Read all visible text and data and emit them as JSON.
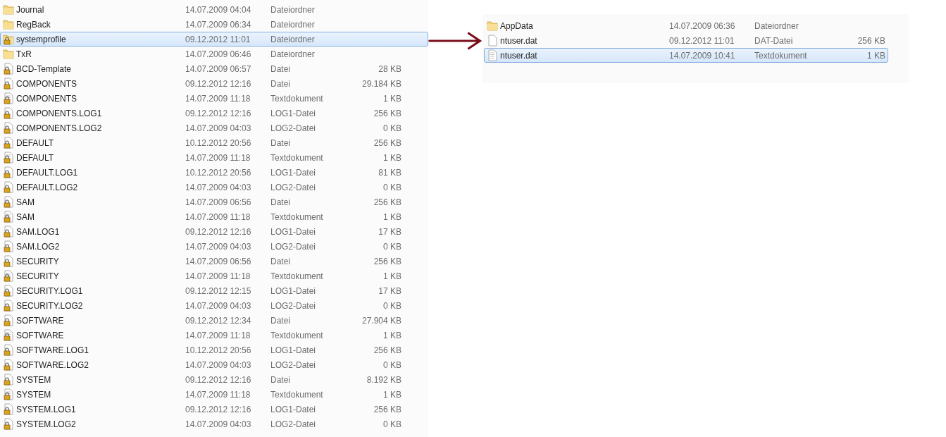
{
  "left_list": {
    "rows": [
      {
        "kind": "folder",
        "name": "Journal",
        "date": "14.07.2009 04:04",
        "type": "Dateiordner",
        "selected": false
      },
      {
        "kind": "folder",
        "name": "RegBack",
        "date": "14.07.2009 06:34",
        "type": "Dateiordner",
        "selected": false
      },
      {
        "kind": "locked-folder",
        "name": "systemprofile",
        "date": "09.12.2012 11:01",
        "type": "Dateiordner",
        "selected": true
      },
      {
        "kind": "folder",
        "name": "TxR",
        "date": "14.07.2009 06:46",
        "type": "Dateiordner",
        "selected": false
      },
      {
        "kind": "locked-file",
        "name": "BCD-Template",
        "date": "14.07.2009 06:57",
        "type": "Datei",
        "size": "28 KB",
        "selected": false
      },
      {
        "kind": "locked-file",
        "name": "COMPONENTS",
        "date": "09.12.2012 12:16",
        "type": "Datei",
        "size": "29.184 KB",
        "selected": false
      },
      {
        "kind": "locked-text",
        "name": "COMPONENTS",
        "date": "14.07.2009 11:18",
        "type": "Textdokument",
        "size": "1 KB",
        "selected": false
      },
      {
        "kind": "locked-file",
        "name": "COMPONENTS.LOG1",
        "date": "09.12.2012 12:16",
        "type": "LOG1-Datei",
        "size": "256 KB",
        "selected": false
      },
      {
        "kind": "locked-file",
        "name": "COMPONENTS.LOG2",
        "date": "14.07.2009 04:03",
        "type": "LOG2-Datei",
        "size": "0 KB",
        "selected": false
      },
      {
        "kind": "locked-file",
        "name": "DEFAULT",
        "date": "10.12.2012 20:56",
        "type": "Datei",
        "size": "256 KB",
        "selected": false
      },
      {
        "kind": "locked-text",
        "name": "DEFAULT",
        "date": "14.07.2009 11:18",
        "type": "Textdokument",
        "size": "1 KB",
        "selected": false
      },
      {
        "kind": "locked-file",
        "name": "DEFAULT.LOG1",
        "date": "10.12.2012 20:56",
        "type": "LOG1-Datei",
        "size": "81 KB",
        "selected": false
      },
      {
        "kind": "locked-file",
        "name": "DEFAULT.LOG2",
        "date": "14.07.2009 04:03",
        "type": "LOG2-Datei",
        "size": "0 KB",
        "selected": false
      },
      {
        "kind": "locked-file",
        "name": "SAM",
        "date": "14.07.2009 06:56",
        "type": "Datei",
        "size": "256 KB",
        "selected": false
      },
      {
        "kind": "locked-text",
        "name": "SAM",
        "date": "14.07.2009 11:18",
        "type": "Textdokument",
        "size": "1 KB",
        "selected": false
      },
      {
        "kind": "locked-file",
        "name": "SAM.LOG1",
        "date": "09.12.2012 12:16",
        "type": "LOG1-Datei",
        "size": "17 KB",
        "selected": false
      },
      {
        "kind": "locked-file",
        "name": "SAM.LOG2",
        "date": "14.07.2009 04:03",
        "type": "LOG2-Datei",
        "size": "0 KB",
        "selected": false
      },
      {
        "kind": "locked-file",
        "name": "SECURITY",
        "date": "14.07.2009 06:56",
        "type": "Datei",
        "size": "256 KB",
        "selected": false
      },
      {
        "kind": "locked-text",
        "name": "SECURITY",
        "date": "14.07.2009 11:18",
        "type": "Textdokument",
        "size": "1 KB",
        "selected": false
      },
      {
        "kind": "locked-file",
        "name": "SECURITY.LOG1",
        "date": "09.12.2012 12:15",
        "type": "LOG1-Datei",
        "size": "17 KB",
        "selected": false
      },
      {
        "kind": "locked-file",
        "name": "SECURITY.LOG2",
        "date": "14.07.2009 04:03",
        "type": "LOG2-Datei",
        "size": "0 KB",
        "selected": false
      },
      {
        "kind": "locked-file",
        "name": "SOFTWARE",
        "date": "09.12.2012 12:34",
        "type": "Datei",
        "size": "27.904 KB",
        "selected": false
      },
      {
        "kind": "locked-text",
        "name": "SOFTWARE",
        "date": "14.07.2009 11:18",
        "type": "Textdokument",
        "size": "1 KB",
        "selected": false
      },
      {
        "kind": "locked-file",
        "name": "SOFTWARE.LOG1",
        "date": "10.12.2012 20:56",
        "type": "LOG1-Datei",
        "size": "256 KB",
        "selected": false
      },
      {
        "kind": "locked-file",
        "name": "SOFTWARE.LOG2",
        "date": "14.07.2009 04:03",
        "type": "LOG2-Datei",
        "size": "0 KB",
        "selected": false
      },
      {
        "kind": "locked-file",
        "name": "SYSTEM",
        "date": "09.12.2012 12:16",
        "type": "Datei",
        "size": "8.192 KB",
        "selected": false
      },
      {
        "kind": "locked-text",
        "name": "SYSTEM",
        "date": "14.07.2009 11:18",
        "type": "Textdokument",
        "size": "1 KB",
        "selected": false
      },
      {
        "kind": "locked-file",
        "name": "SYSTEM.LOG1",
        "date": "09.12.2012 12:16",
        "type": "LOG1-Datei",
        "size": "256 KB",
        "selected": false
      },
      {
        "kind": "locked-file",
        "name": "SYSTEM.LOG2",
        "date": "14.07.2009 04:03",
        "type": "LOG2-Datei",
        "size": "0 KB",
        "selected": false
      }
    ]
  },
  "right_list": {
    "rows": [
      {
        "kind": "folder",
        "name": "AppData",
        "date": "14.07.2009 06:36",
        "type": "Dateiordner",
        "selected": false
      },
      {
        "kind": "file",
        "name": "ntuser.dat",
        "date": "09.12.2012 11:01",
        "type": "DAT-Datei",
        "size": "256 KB",
        "selected": false
      },
      {
        "kind": "text",
        "name": "ntuser.dat",
        "date": "14.07.2009 10:41",
        "type": "Textdokument",
        "size": "1 KB",
        "selected": true
      }
    ]
  }
}
